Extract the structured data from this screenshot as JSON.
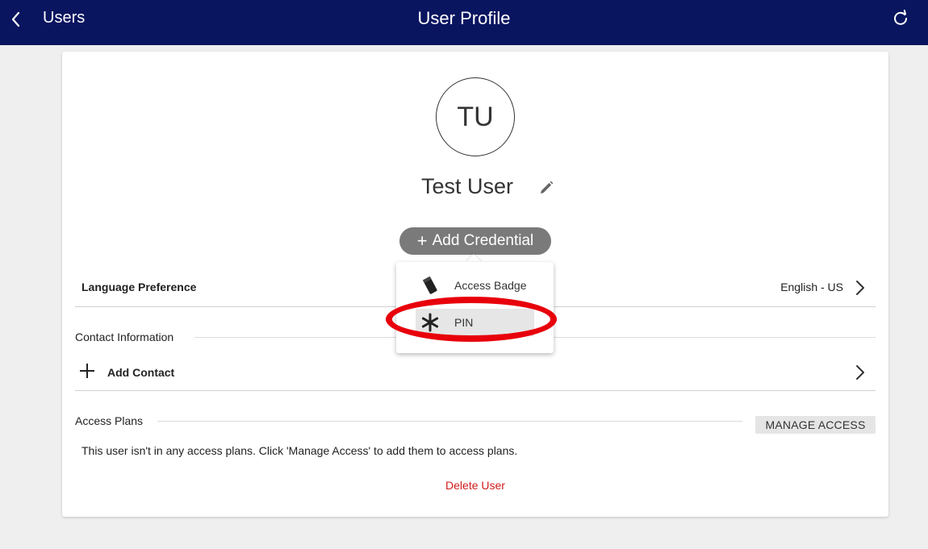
{
  "header": {
    "back_label": "Users",
    "title": "User Profile",
    "bar_color": "#0a1560"
  },
  "profile": {
    "initials": "TU",
    "name": "Test User"
  },
  "add_credential": {
    "label": "Add Credential",
    "menu": [
      {
        "label": "Access Badge",
        "icon": "badge-icon"
      },
      {
        "label": "PIN",
        "icon": "asterisk-icon",
        "highlighted": true
      }
    ]
  },
  "language": {
    "label": "Language Preference",
    "value": "English - US"
  },
  "contact": {
    "section_title": "Contact Information",
    "add_label": "Add Contact"
  },
  "access_plans": {
    "section_title": "Access Plans",
    "manage_label": "MANAGE ACCESS",
    "empty_message": "This user isn't in any access plans. Click 'Manage Access' to add them to access plans."
  },
  "delete_label": "Delete User",
  "colors": {
    "danger": "#d01b1b",
    "annotation": "#e8000b"
  }
}
